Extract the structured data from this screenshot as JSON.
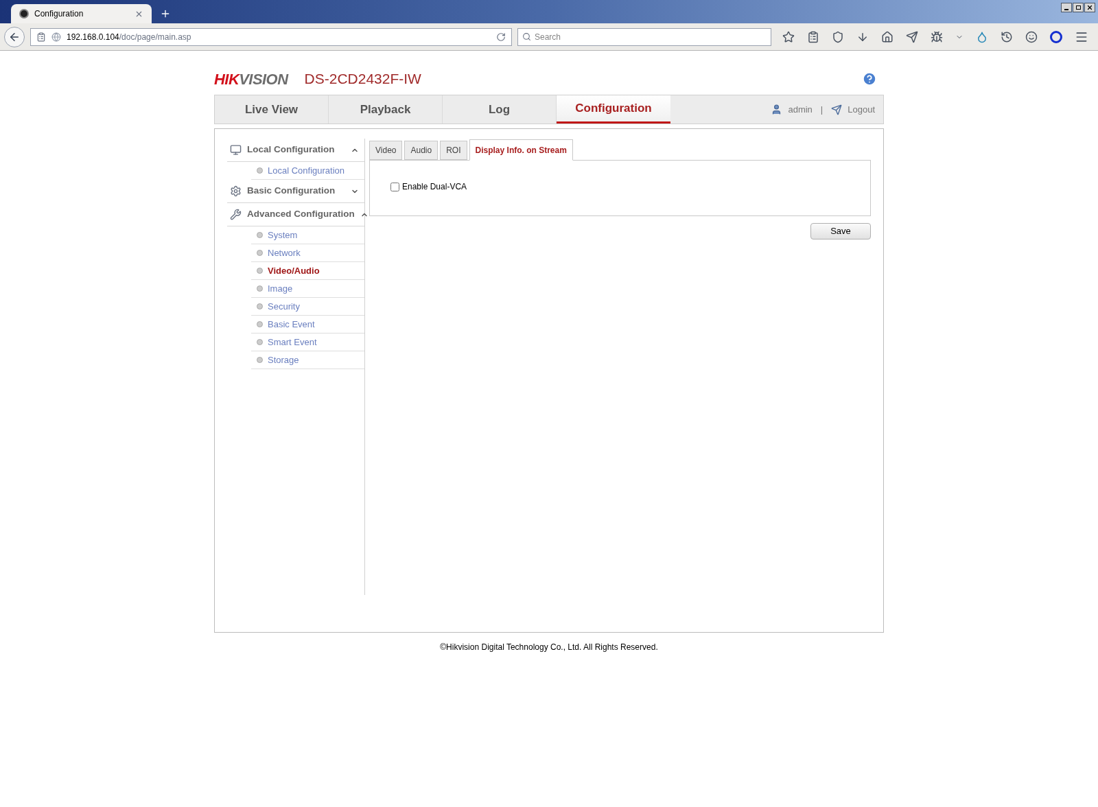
{
  "browser": {
    "tab": {
      "title": "Configuration"
    },
    "address": {
      "host": "192.168.0.104",
      "path": "/doc/page/main.asp"
    },
    "search": {
      "placeholder": "Search"
    }
  },
  "header": {
    "logo": [
      "HIK",
      "VISION"
    ],
    "model": "DS-2CD2432F-IW"
  },
  "nav": {
    "tabs": [
      {
        "label": "Live View",
        "selected": false
      },
      {
        "label": "Playback",
        "selected": false
      },
      {
        "label": "Log",
        "selected": false
      },
      {
        "label": "Configuration",
        "selected": true
      }
    ],
    "user": "admin",
    "separator": "|",
    "logout": "Logout"
  },
  "sidebar": {
    "groups": [
      {
        "kind": "local",
        "label": "Local Configuration",
        "expanded": true,
        "children": [
          {
            "label": "Local Configuration",
            "selected": false
          }
        ]
      },
      {
        "kind": "basic",
        "label": "Basic Configuration",
        "expanded": false
      },
      {
        "kind": "advanced",
        "label": "Advanced Configuration",
        "expanded": true,
        "children": [
          {
            "label": "System",
            "selected": false
          },
          {
            "label": "Network",
            "selected": false
          },
          {
            "label": "Video/Audio",
            "selected": true
          },
          {
            "label": "Image",
            "selected": false
          },
          {
            "label": "Security",
            "selected": false
          },
          {
            "label": "Basic Event",
            "selected": false
          },
          {
            "label": "Smart Event",
            "selected": false
          },
          {
            "label": "Storage",
            "selected": false
          }
        ]
      }
    ]
  },
  "sub_tabs": [
    {
      "label": "Video",
      "selected": false
    },
    {
      "label": "Audio",
      "selected": false
    },
    {
      "label": "ROI",
      "selected": false
    },
    {
      "label": "Display Info. on Stream",
      "selected": true
    }
  ],
  "form": {
    "checkbox": {
      "label": "Enable Dual-VCA",
      "checked": false
    },
    "save": "Save"
  },
  "footer": "©Hikvision Digital Technology Co., Ltd. All Rights Reserved."
}
